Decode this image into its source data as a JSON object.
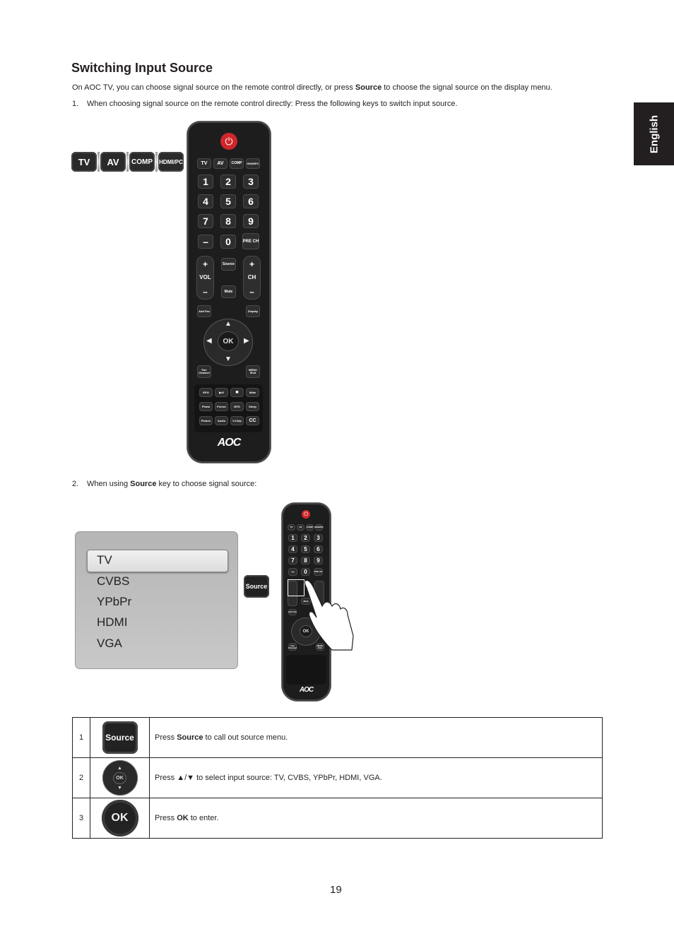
{
  "page": {
    "title": "Switching Input Source",
    "intro": {
      "pre": "On AOC TV, you can choose signal source on the remote control directly, or press ",
      "bold": "Source",
      "post": " to choose the signal source on the display menu."
    },
    "step1": {
      "num": "1.",
      "text": "When choosing signal source on the remote control directly: Press the following keys to switch input source."
    },
    "step2": {
      "num": "2.",
      "pre": "When using ",
      "bold": "Source",
      "post": " key to choose signal source:"
    },
    "side_tab": "English",
    "page_number": "19"
  },
  "source_keys": [
    "TV",
    "AV",
    "COMP",
    "HDMI/PC"
  ],
  "remote": {
    "input_keys": [
      "TV",
      "AV",
      "COMP",
      "HDMI/PC"
    ],
    "digits": [
      "1",
      "2",
      "3",
      "4",
      "5",
      "6",
      "7",
      "8",
      "9",
      "–",
      "0",
      "PRE CH"
    ],
    "vol": {
      "plus": "+",
      "label": "VOL",
      "minus": "–"
    },
    "ch": {
      "plus": "+",
      "label": "CH",
      "minus": "–"
    },
    "source": "Source",
    "mute": "Mute",
    "add_fav": "Add Fav",
    "display": "Display",
    "ok": "OK",
    "fav_channel": "Fav Channel",
    "menu_exit": "MENU /Exit",
    "bottom_keys": [
      "EPG",
      "▶/II",
      "■",
      "Wide",
      "Photo",
      "Freeze",
      "MTS",
      "Sleep",
      "Picture",
      "Audio",
      "V-Chip",
      "CC"
    ],
    "logo": "AOC"
  },
  "source_menu": {
    "items": [
      "TV",
      "CVBS",
      "YPbPr",
      "HDMI",
      "VGA"
    ],
    "selected": "TV",
    "key_label": "Source"
  },
  "steps_table": [
    {
      "num": "1",
      "icon": "Source",
      "pre": "Press ",
      "bold": "Source",
      "post": " to call out source menu."
    },
    {
      "num": "2",
      "icon": "OK",
      "pre": "Press ",
      "bold": "",
      "post": "▲/▼ to select input source: TV, CVBS, YPbPr, HDMI, VGA."
    },
    {
      "num": "3",
      "icon": "OK",
      "pre": "Press ",
      "bold": "OK",
      "post": " to enter."
    }
  ]
}
